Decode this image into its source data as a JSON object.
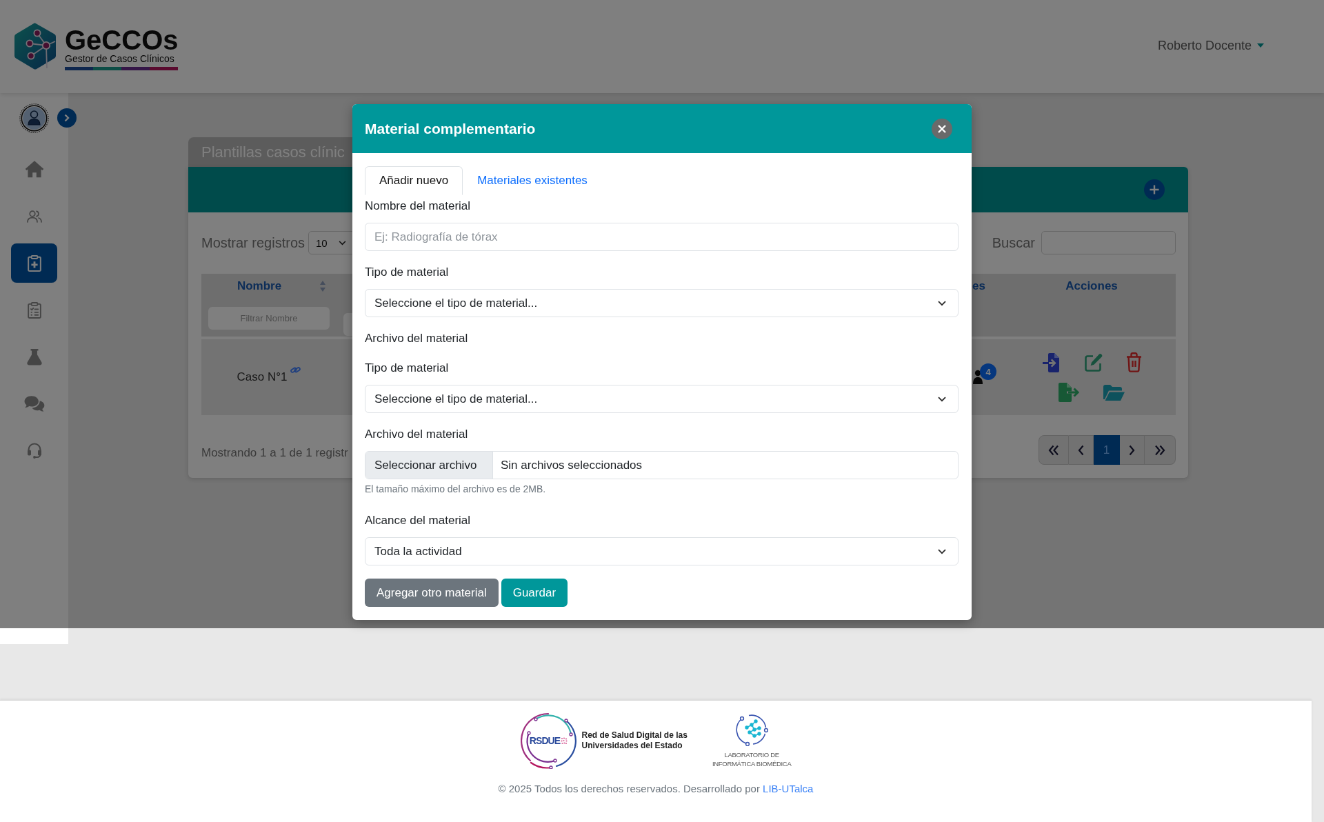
{
  "header": {
    "logo": {
      "title": "GeCCOs",
      "subtitle": "Gestor de Casos Clínicos"
    },
    "user_menu": {
      "label": "Roberto Docente"
    }
  },
  "sidebar": {
    "items": [
      {
        "selected": false
      },
      {
        "selected": false
      },
      {
        "selected": true
      },
      {
        "selected": false
      },
      {
        "selected": false
      },
      {
        "selected": false
      },
      {
        "selected": false
      }
    ]
  },
  "card": {
    "title": "Plantillas casos clínic",
    "length_menu": {
      "label": "Mostrar registros",
      "value": "10"
    },
    "search": {
      "label": "Buscar"
    },
    "table": {
      "columns": [
        {
          "label": "Nombre",
          "sortable": true,
          "filter_placeholder": "Filtrar Nombre"
        },
        {
          "label": "es",
          "sortable": false
        },
        {
          "label": "Acciones",
          "sortable": false
        }
      ],
      "rows": [
        {
          "name": "Caso N°1",
          "badge": "4"
        }
      ]
    },
    "info": "Mostrando 1 a 1 de 1 registr",
    "pagination": {
      "pages": [
        {
          "label": "1",
          "selected": true
        }
      ]
    }
  },
  "modal": {
    "title": "Material complementario",
    "tabs": [
      {
        "label": "Añadir nuevo",
        "selected": true
      },
      {
        "label": "Materiales existentes",
        "selected": false
      }
    ],
    "fields": [
      {
        "kind": "text",
        "label": "Nombre del material",
        "placeholder": "Ej: Radiografía de tórax"
      },
      {
        "kind": "select",
        "label": "Tipo de material",
        "value": "Seleccione el tipo de material..."
      },
      {
        "kind": "heading",
        "label": "Archivo del material"
      },
      {
        "kind": "select",
        "label": "Tipo de material",
        "value": "Seleccione el tipo de material..."
      },
      {
        "kind": "file",
        "label": "Archivo del material",
        "button": "Seleccionar archivo",
        "value": "Sin archivos seleccionados",
        "help": "El tamaño máximo del archivo es de 2MB."
      },
      {
        "kind": "select",
        "label": "Alcance del material",
        "value": "Toda la actividad"
      }
    ],
    "buttons": [
      {
        "label": "Agregar otro material",
        "kind": "secondary"
      },
      {
        "label": "Guardar",
        "kind": "primary"
      }
    ]
  },
  "footer": {
    "partners": [
      {
        "kind": "ring",
        "mark": "RSDUE",
        "lines": [
          "Red de Salud Digital de las",
          "Universidades del Estado"
        ]
      },
      {
        "kind": "network",
        "lines": [
          "LABORATORIO DE",
          "INFORMÁTICA BIOMÉDICA"
        ]
      }
    ],
    "copyright": "© 2025 Todos los derechos reservados. Desarrollado por",
    "link": "LIB-UTalca"
  }
}
